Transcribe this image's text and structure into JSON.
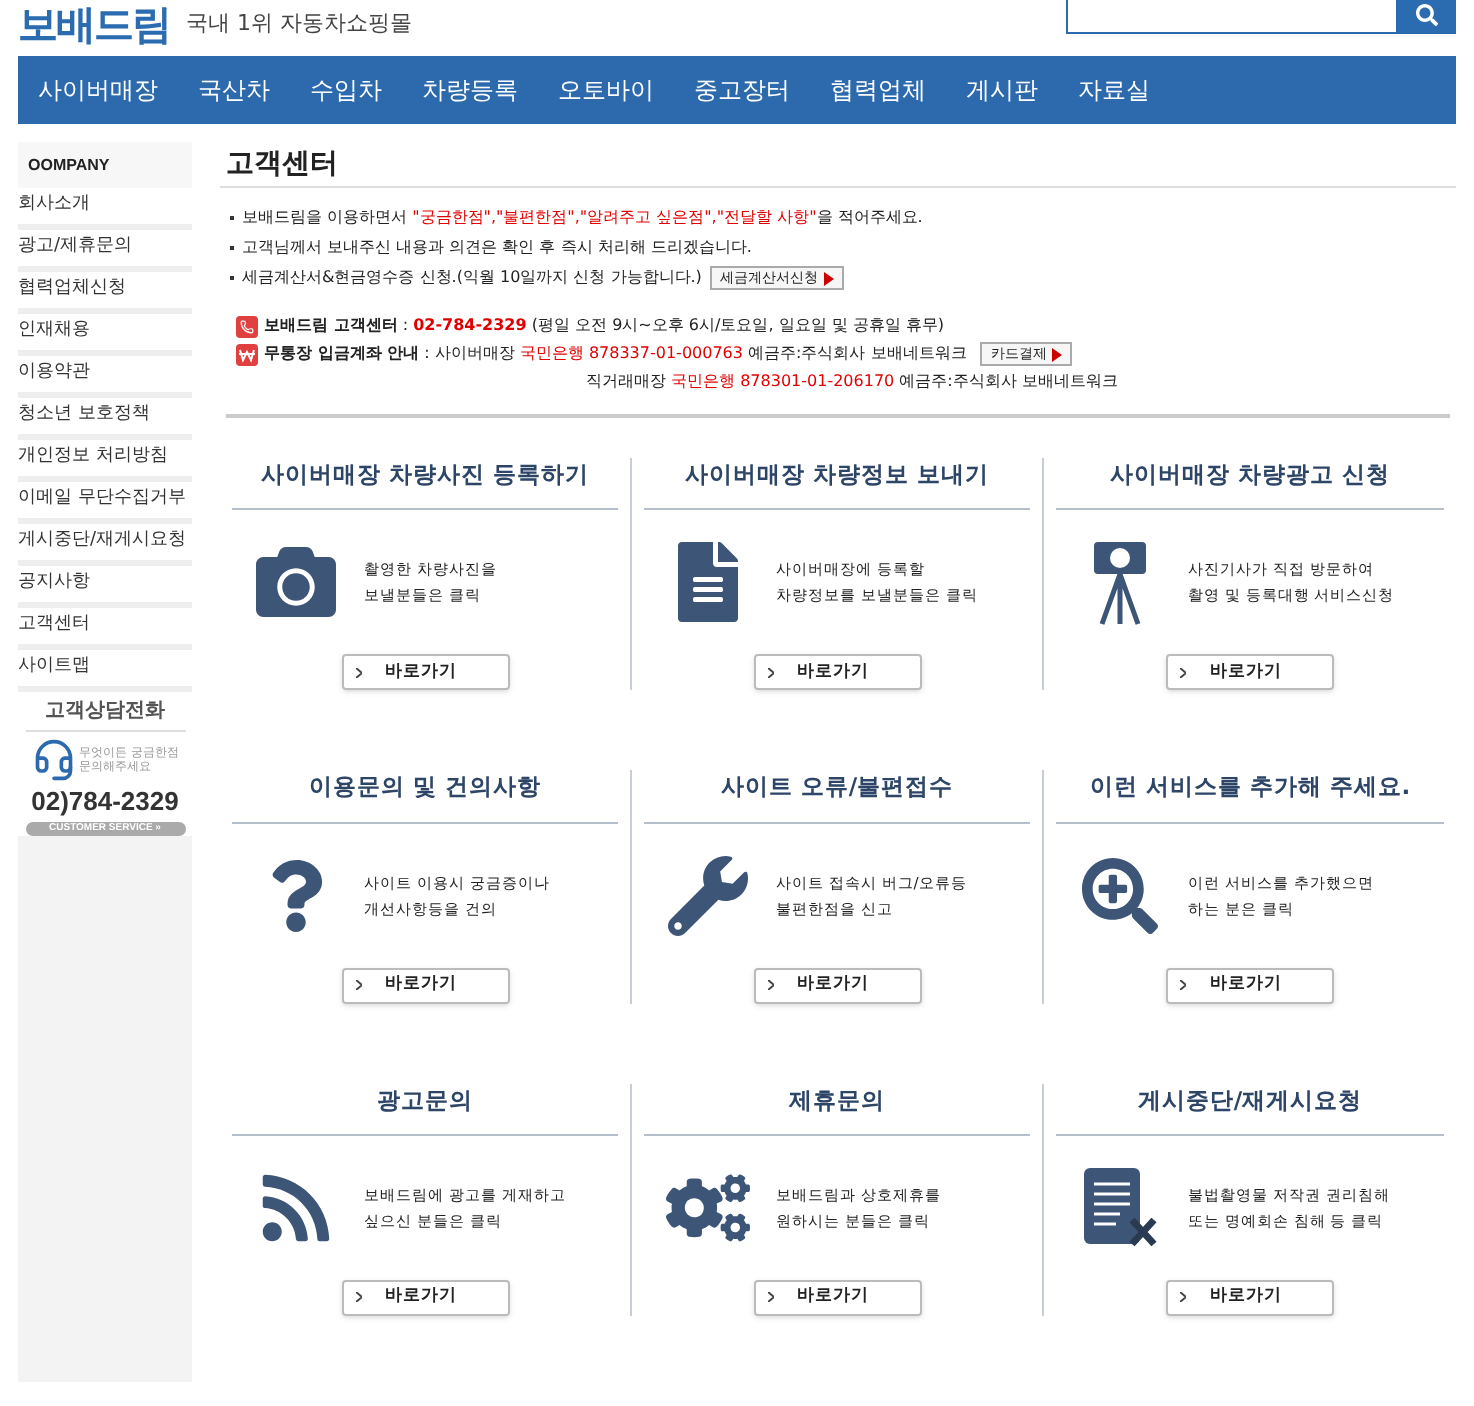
{
  "header": {
    "logo": "보배드림",
    "tagline": "국내 1위 자동차쇼핑몰"
  },
  "nav": [
    "사이버매장",
    "국산차",
    "수입차",
    "차량등록",
    "오토바이",
    "중고장터",
    "협력업체",
    "게시판",
    "자료실"
  ],
  "sidebar": {
    "heading": "OOMPANY",
    "items": [
      "회사소개",
      "광고/제휴문의",
      "협력업체신청",
      "인재채용",
      "이용약관",
      "청소년 보호정책",
      "개인정보 처리방침",
      "이메일 무단수집거부",
      "게시중단/재게시요청",
      "공지사항",
      "고객센터",
      "사이트맵"
    ],
    "phone_title": "고객상담전화",
    "phone_note": "무엇이든 궁금한점 문의해주세요",
    "phone": "02)784-2329",
    "badge": "CUSTOMER SERVICE »"
  },
  "page_title": "고객센터",
  "notices": [
    [
      {
        "text": "보배드림을 이용하면서 ",
        "kind": "plain"
      },
      {
        "text": "\"궁금한점\",\"불편한점\",\"알려주고 싶은점\",\"전달할 사항\"",
        "kind": "red"
      },
      {
        "text": "을 적어주세요.",
        "kind": "plain"
      }
    ],
    [
      {
        "text": "고객님께서 보내주신 내용과 의견은 확인 후 즉시 처리해 드리겠습니다.",
        "kind": "plain"
      }
    ],
    [
      {
        "text": "세금계산서&현금영수증 신청.(익월 10일까지 신청 가능합니다.)",
        "kind": "plain"
      }
    ]
  ],
  "tax_button": "세금계산서신청",
  "contact": [
    {
      "kind": "phone",
      "parts": [
        {
          "text": "보배드림 고객센터",
          "kind": "bold"
        },
        {
          "text": " : ",
          "kind": "plain"
        },
        {
          "text": "02-784-2329",
          "kind": "redbold"
        },
        {
          "text": " (평일 오전 9시~오후 6시/토요일, 일요일 및 공휴일 휴무)",
          "kind": "plain"
        }
      ]
    },
    {
      "kind": "bank",
      "parts": [
        {
          "text": "무통장 입금계좌 안내",
          "kind": "bold"
        },
        {
          "text": " : 사이버매장 ",
          "kind": "plain"
        },
        {
          "text": "국민은행 878337-01-000763",
          "kind": "red"
        },
        {
          "text": " 예금주:주식회사 보배네트워크",
          "kind": "plain"
        }
      ],
      "button": "카드결제"
    },
    {
      "kind": "indent",
      "parts": [
        {
          "text": "직거래매장 ",
          "kind": "plain"
        },
        {
          "text": "국민은행 878301-01-206170",
          "kind": "red"
        },
        {
          "text": " 예금주:주식회사 보배네트워크",
          "kind": "plain"
        }
      ]
    }
  ],
  "cards": [
    {
      "title": "사이버매장 차량사진 등록하기",
      "lines": [
        "촬영한 차량사진을",
        "보낼분들은 클릭"
      ],
      "button": "바로가기"
    },
    {
      "title": "사이버매장 차량정보 보내기",
      "lines": [
        "사이버매장에 등록할",
        "차량정보를 보낼분들은 클릭"
      ],
      "button": "바로가기"
    },
    {
      "title": "사이버매장 차량광고 신청",
      "lines": [
        "사진기사가 직접 방문하여",
        "촬영 및 등록대행 서비스신청"
      ],
      "button": "바로가기"
    },
    {
      "title": "이용문의 및 건의사항",
      "lines": [
        "사이트 이용시 궁금증이나",
        "개선사항등을 건의"
      ],
      "button": "바로가기"
    },
    {
      "title": "사이트 오류/불편접수",
      "lines": [
        "사이트 접속시 버그/오류등",
        "불편한점을 신고"
      ],
      "button": "바로가기"
    },
    {
      "title": "이런 서비스를 추가해 주세요.",
      "lines": [
        "이런 서비스를 추가했으면",
        "하는 분은 클릭"
      ],
      "button": "바로가기"
    },
    {
      "title": "광고문의",
      "lines": [
        "보배드림에 광고를 게재하고",
        "싶으신 분들은 클릭"
      ],
      "button": "바로가기"
    },
    {
      "title": "제휴문의",
      "lines": [
        "보배드림과 상호제휴를",
        "원하시는 분들은 클릭"
      ],
      "button": "바로가기"
    },
    {
      "title": "게시중단/재게시요청",
      "lines": [
        "불법촬영물 저작권 권리침해",
        "또는 명예회손 침해 등 클릭"
      ],
      "button": "바로가기"
    }
  ]
}
